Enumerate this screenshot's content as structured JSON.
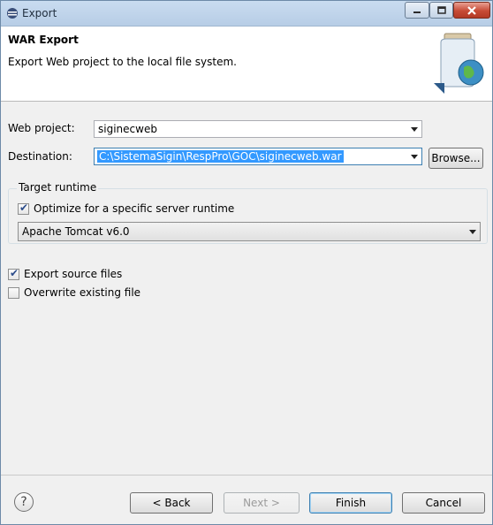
{
  "window": {
    "title": "Export"
  },
  "header": {
    "title": "WAR Export",
    "description": "Export Web project to the local file system."
  },
  "form": {
    "web_project_label": "Web project:",
    "web_project_value": "siginecweb",
    "destination_label": "Destination:",
    "destination_value": "C:\\SistemaSigin\\RespPro\\GOC\\siginecweb.war",
    "browse_label": "Browse..."
  },
  "target_runtime": {
    "group_label": "Target runtime",
    "optimize_label": "Optimize for a specific server runtime",
    "optimize_checked": true,
    "runtime_value": "Apache Tomcat v6.0"
  },
  "options": {
    "export_source_label": "Export source files",
    "export_source_checked": true,
    "overwrite_label": "Overwrite existing file",
    "overwrite_checked": false
  },
  "buttons": {
    "back": "< Back",
    "next": "Next >",
    "finish": "Finish",
    "cancel": "Cancel",
    "help": "?"
  },
  "colors": {
    "accent": "#3399ff",
    "title_bar": "#b7cde6",
    "close_button": "#c74a35"
  }
}
